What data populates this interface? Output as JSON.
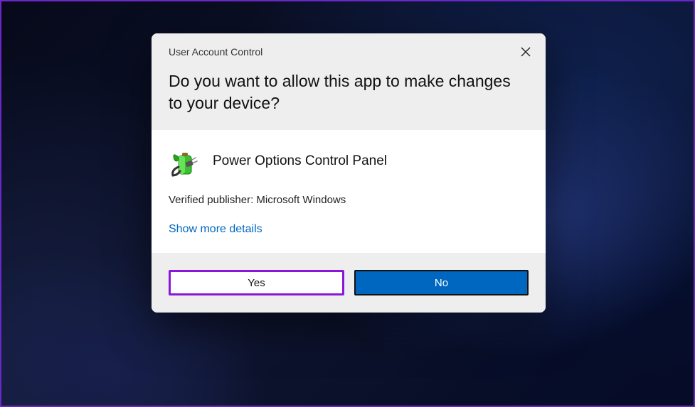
{
  "dialog": {
    "title": "User Account Control",
    "heading": "Do you want to allow this app to make changes to your device?",
    "app_name": "Power Options Control Panel",
    "publisher_line": "Verified publisher: Microsoft Windows",
    "details_link": "Show more details",
    "yes_label": "Yes",
    "no_label": "No"
  },
  "colors": {
    "accent": "#0067c0",
    "highlight": "#8a17d8"
  }
}
